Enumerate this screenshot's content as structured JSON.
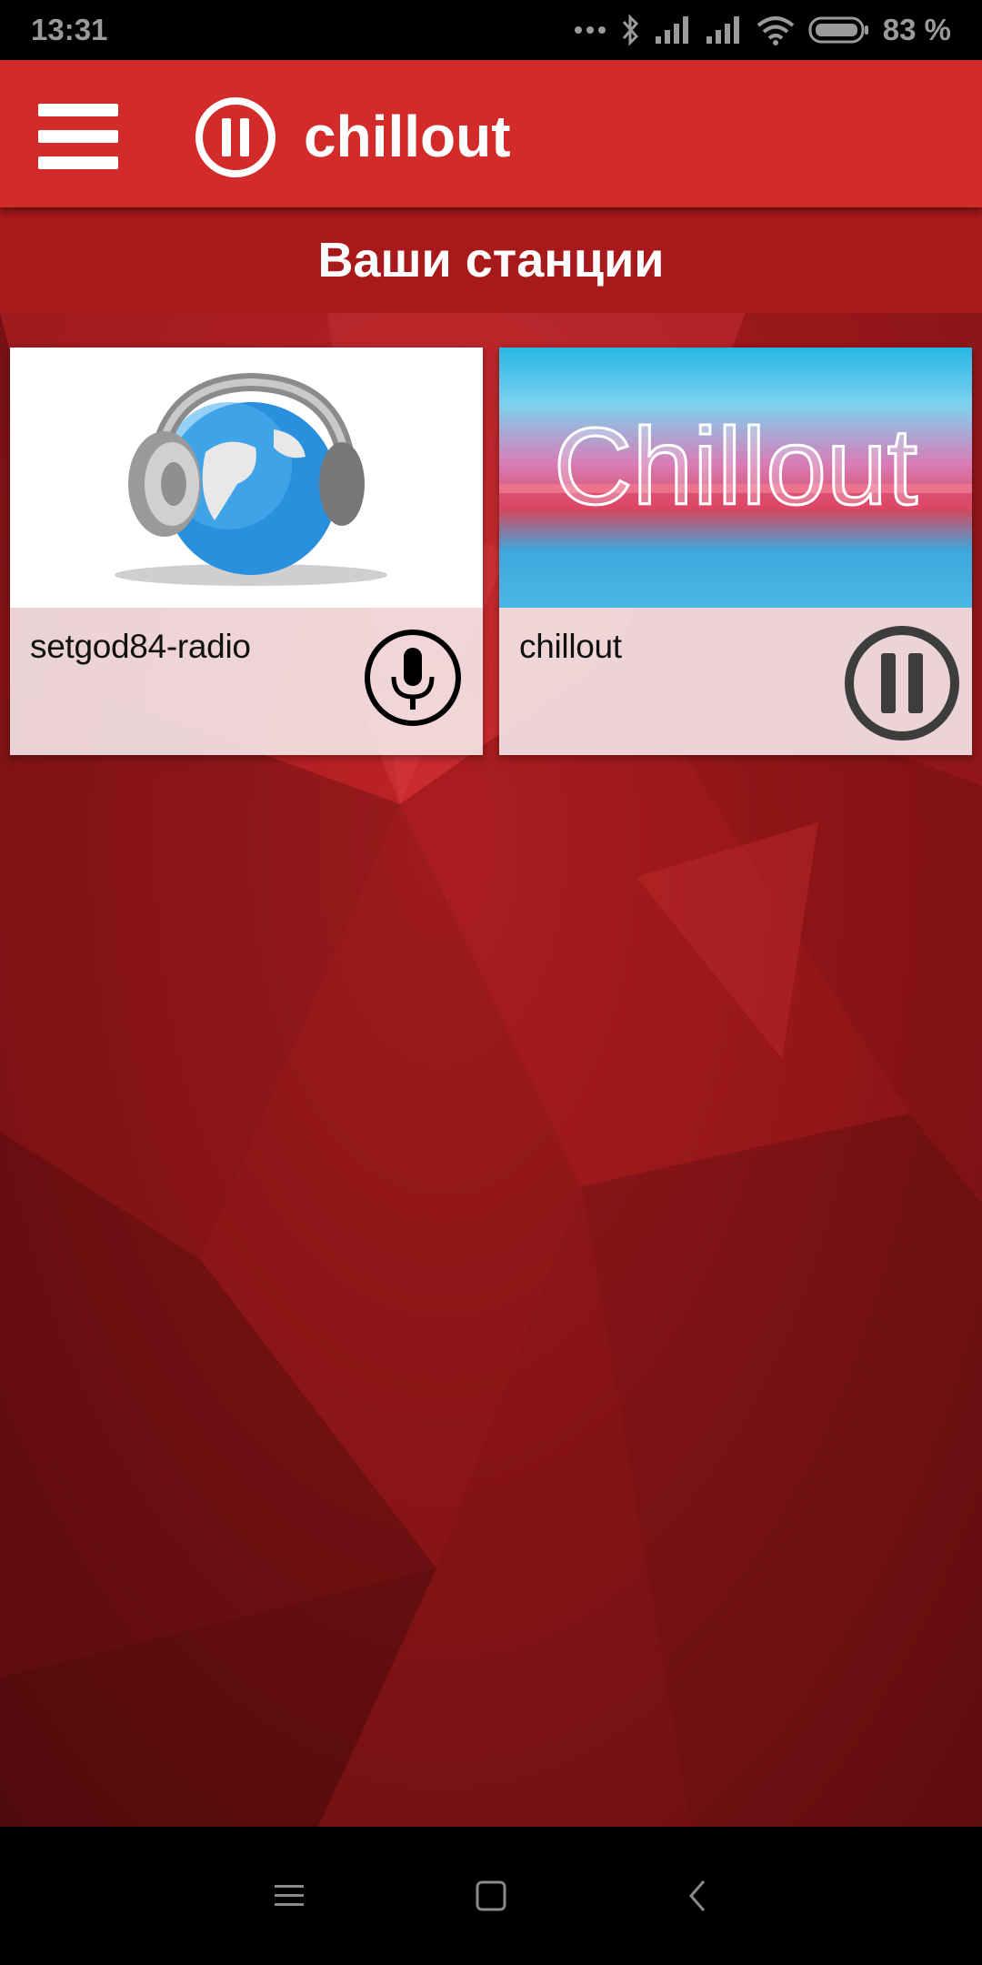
{
  "status_bar": {
    "time": "13:31",
    "battery": "83 %",
    "icons": [
      "dots-icon",
      "bluetooth-icon",
      "signal-icon",
      "signal-icon",
      "wifi-icon",
      "battery-icon"
    ]
  },
  "app_bar": {
    "title": "chillout",
    "menu_icon": "hamburger-menu-icon",
    "logo_icon": "pause-circle-icon"
  },
  "section": {
    "title": "Ваши станции"
  },
  "stations": [
    {
      "name": "setgod84-radio",
      "artwork": "headphones-globe",
      "action_icon": "microphone-icon"
    },
    {
      "name": "chillout",
      "artwork": "chillout-sunset",
      "artwork_text": "Chillout",
      "action_icon": "pause-circle-icon"
    }
  ],
  "nav_bar": {
    "icons": [
      "recents-menu-icon",
      "home-square-icon",
      "back-chevron-icon"
    ]
  },
  "colors": {
    "app_bar": "#d32a2a",
    "section_header": "#a8191b",
    "background": "#8e1517"
  }
}
